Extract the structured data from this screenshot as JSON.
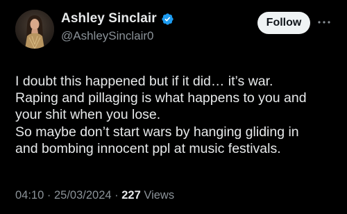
{
  "author": {
    "display_name": "Ashley Sinclair",
    "handle": "@AshleySinclair0",
    "verified": true,
    "verified_icon": "verified-badge-icon",
    "avatar": "profile-photo"
  },
  "actions": {
    "follow_label": "Follow",
    "more_icon": "more-dots-icon"
  },
  "tweet": {
    "lines": [
      "I doubt this happened but if it did… it’s war.",
      "Raping and pillaging is what happens to you and",
      "your shit when you lose.",
      "So maybe don’t start wars by hanging gliding in",
      "and bombing innocent ppl at music festivals."
    ]
  },
  "meta": {
    "time": "04:10",
    "separator": " · ",
    "date": "25/03/2024",
    "views_count": "227",
    "views_label": "Views"
  },
  "colors": {
    "background": "#000000",
    "text": "#e7e9ea",
    "secondary": "#8b9298",
    "verified": "#1d9bf0",
    "follow_bg": "#eff3f4"
  }
}
